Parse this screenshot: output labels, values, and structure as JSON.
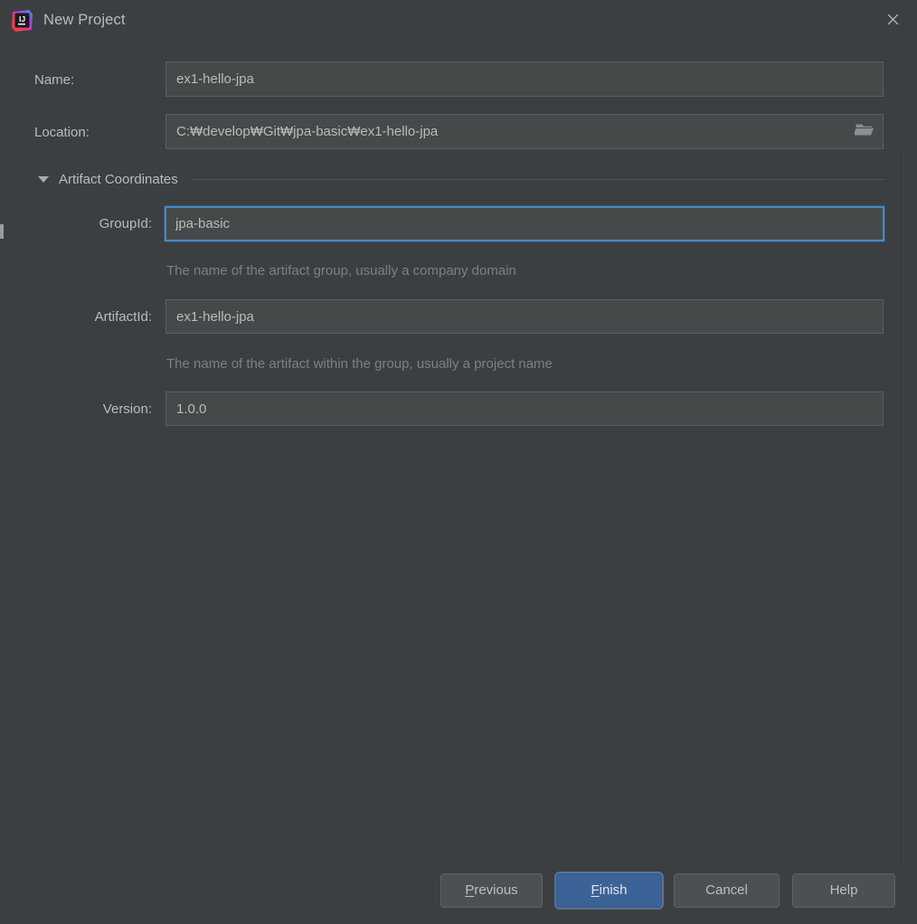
{
  "window": {
    "title": "New Project",
    "icon": "intellij-idea-icon",
    "close_label": "×"
  },
  "form": {
    "name": {
      "label": "Name:",
      "value": "ex1-hello-jpa",
      "placeholder": ""
    },
    "location": {
      "label": "Location:",
      "value": "C:₩develop₩Git₩jpa-basic₩ex1-hello-jpa",
      "placeholder": "",
      "browse_icon": "folder-icon"
    }
  },
  "artifact_section": {
    "title": "Artifact Coordinates",
    "expanded": true,
    "twisty_icon": "chevron-down-icon",
    "group_id": {
      "label": "GroupId:",
      "value": "jpa-basic",
      "placeholder": "",
      "focused": true,
      "hint": "The name of the artifact group, usually a company domain"
    },
    "artifact_id": {
      "label": "ArtifactId:",
      "value": "ex1-hello-jpa",
      "placeholder": "",
      "focused": false,
      "hint": "The name of the artifact within the group, usually a project name"
    },
    "version": {
      "label": "Version:",
      "value": "1.0.0",
      "placeholder": "",
      "focused": false
    }
  },
  "buttons": {
    "previous": {
      "label": "Previous",
      "mnemonic": "P",
      "default": false
    },
    "finish": {
      "label": "Finish",
      "mnemonic": "F",
      "default": true
    },
    "cancel": {
      "label": "Cancel",
      "mnemonic": "",
      "default": false
    },
    "help": {
      "label": "Help",
      "mnemonic": "",
      "default": false
    }
  },
  "colors": {
    "dialog_bg": "#3c3f41",
    "field_bg": "#45494a",
    "field_border": "#5b5f61",
    "focus_blue": "#4a88c7",
    "default_button_blue": "#3c6398",
    "text": "#b9bcbd",
    "hint_text": "#7c8082"
  }
}
